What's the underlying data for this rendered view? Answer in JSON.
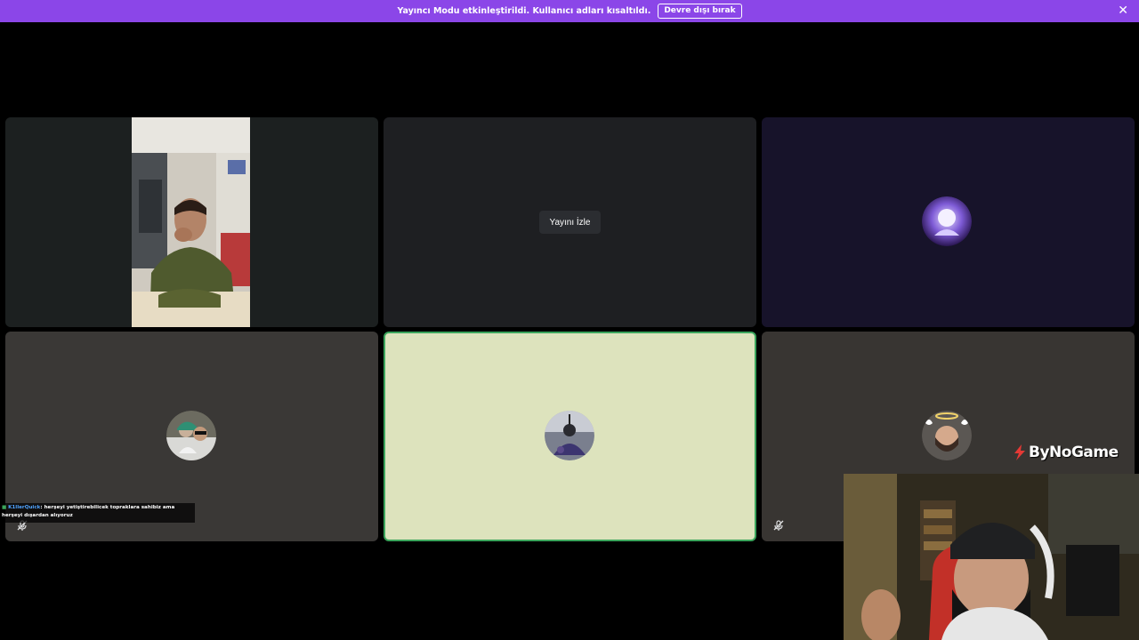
{
  "banner": {
    "message": "Yayıncı Modu etkinleştirildi. Kullanıcı adları kısaltıldı.",
    "disable_label": "Devre dışı bırak",
    "close_glyph": "✕",
    "color": "#8b46e8"
  },
  "tiles": {
    "screen_share": {
      "watch_label": "Yayını İzle"
    }
  },
  "chat_overlay": {
    "username": "K1llerQuick",
    "message": ": herşeyi yetiştirebilicek topraklara sahibiz ama herşeyi dışardan alıyoruz"
  },
  "brand": {
    "name": "ByNoGame",
    "color": "#e53935"
  },
  "icons": {
    "mute": "microphone-muted-icon",
    "close": "close-icon"
  },
  "colors": {
    "speaking_border": "#3ba55c",
    "background": "#000000"
  }
}
